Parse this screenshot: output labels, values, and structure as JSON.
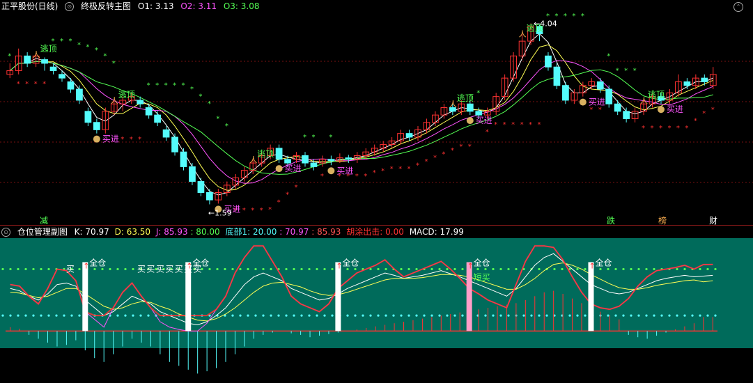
{
  "main_header": {
    "title": "正平股份(日线)",
    "indicator_name": "终极反转主图",
    "o1": "O1: 3.13",
    "o2": "O2: 3.11",
    "o3": "O3: 3.08"
  },
  "sub_header": {
    "indicator_name": "仓位管理副图",
    "k": "K: 70.97",
    "d": "D: 63.50",
    "j": "J: 85.93",
    "j_extra": ": 80.00",
    "bottom": "底部1: 20.00",
    "v2": ": 70.97",
    "v3": ": 85.93",
    "exit": "胡涂出击: 0.00",
    "macd": "MACD: 17.99"
  },
  "labels": {
    "escape": "逃顶",
    "buy": "买进",
    "full": "全仓",
    "buy_short": "买",
    "short_buy": "短买",
    "high": "4.04",
    "low": "1.59",
    "reduce": "减",
    "drop": "跌",
    "rank": "榜",
    "fin": "财"
  },
  "colors": {
    "up": "#ff3232",
    "down": "#54fcfc",
    "ma_white": "#ffffff",
    "ma_yellow": "#ffff54",
    "ma_magenta": "#ff54ff",
    "ma_green": "#54ff54",
    "sub_bg": "#006b5b",
    "grid": "#7a1010"
  },
  "chart_data": [
    {
      "type": "candlestick",
      "title": "终极反转主图",
      "y_range": [
        1.5,
        4.15
      ],
      "high_marker": 4.04,
      "low_marker": 1.59,
      "candles": [
        {
          "o": 3.35,
          "c": 3.4,
          "h": 3.5,
          "l": 3.3
        },
        {
          "o": 3.4,
          "c": 3.6,
          "h": 3.7,
          "l": 3.35
        },
        {
          "o": 3.6,
          "c": 3.5,
          "h": 3.65,
          "l": 3.45
        },
        {
          "o": 3.5,
          "c": 3.6,
          "h": 3.62,
          "l": 3.45
        },
        {
          "o": 3.55,
          "c": 3.5,
          "h": 3.58,
          "l": 3.4
        },
        {
          "o": 3.45,
          "c": 3.4,
          "h": 3.5,
          "l": 3.35
        },
        {
          "o": 3.35,
          "c": 3.3,
          "h": 3.4,
          "l": 3.25
        },
        {
          "o": 3.25,
          "c": 3.15,
          "h": 3.3,
          "l": 3.1
        },
        {
          "o": 3.15,
          "c": 3.0,
          "h": 3.2,
          "l": 2.95
        },
        {
          "o": 2.85,
          "c": 2.7,
          "h": 2.9,
          "l": 2.65
        },
        {
          "o": 2.7,
          "c": 2.6,
          "h": 2.75,
          "l": 2.55
        },
        {
          "o": 2.6,
          "c": 2.85,
          "h": 2.9,
          "l": 2.55
        },
        {
          "o": 2.85,
          "c": 2.95,
          "h": 3.0,
          "l": 2.8
        },
        {
          "o": 2.95,
          "c": 3.0,
          "h": 3.05,
          "l": 2.85
        },
        {
          "o": 3.0,
          "c": 3.05,
          "h": 3.1,
          "l": 2.95
        },
        {
          "o": 3.0,
          "c": 2.95,
          "h": 3.05,
          "l": 2.9
        },
        {
          "o": 2.9,
          "c": 2.8,
          "h": 2.95,
          "l": 2.75
        },
        {
          "o": 2.8,
          "c": 2.7,
          "h": 2.85,
          "l": 2.65
        },
        {
          "o": 2.6,
          "c": 2.5,
          "h": 2.65,
          "l": 2.45
        },
        {
          "o": 2.5,
          "c": 2.3,
          "h": 2.55,
          "l": 2.25
        },
        {
          "o": 2.3,
          "c": 2.1,
          "h": 2.35,
          "l": 2.05
        },
        {
          "o": 2.1,
          "c": 1.9,
          "h": 2.15,
          "l": 1.85
        },
        {
          "o": 1.9,
          "c": 1.75,
          "h": 1.95,
          "l": 1.7
        },
        {
          "o": 1.75,
          "c": 1.65,
          "h": 1.8,
          "l": 1.59
        },
        {
          "o": 1.65,
          "c": 1.75,
          "h": 1.8,
          "l": 1.6
        },
        {
          "o": 1.75,
          "c": 1.85,
          "h": 1.9,
          "l": 1.7
        },
        {
          "o": 1.85,
          "c": 1.95,
          "h": 2.0,
          "l": 1.8
        },
        {
          "o": 1.95,
          "c": 2.05,
          "h": 2.1,
          "l": 1.9
        },
        {
          "o": 2.05,
          "c": 2.15,
          "h": 2.2,
          "l": 2.0
        },
        {
          "o": 2.15,
          "c": 2.25,
          "h": 2.3,
          "l": 2.1
        },
        {
          "o": 2.25,
          "c": 2.35,
          "h": 2.4,
          "l": 2.2
        },
        {
          "o": 2.35,
          "c": 2.2,
          "h": 2.4,
          "l": 2.15
        },
        {
          "o": 2.2,
          "c": 2.15,
          "h": 2.25,
          "l": 2.1
        },
        {
          "o": 2.2,
          "c": 2.25,
          "h": 2.3,
          "l": 2.15
        },
        {
          "o": 2.25,
          "c": 2.15,
          "h": 2.3,
          "l": 2.1
        },
        {
          "o": 2.15,
          "c": 2.1,
          "h": 2.2,
          "l": 2.05
        },
        {
          "o": 2.15,
          "c": 2.2,
          "h": 2.25,
          "l": 2.1
        },
        {
          "o": 2.2,
          "c": 2.18,
          "h": 2.25,
          "l": 2.12
        },
        {
          "o": 2.18,
          "c": 2.22,
          "h": 2.28,
          "l": 2.15
        },
        {
          "o": 2.22,
          "c": 2.2,
          "h": 2.26,
          "l": 2.15
        },
        {
          "o": 2.2,
          "c": 2.25,
          "h": 2.3,
          "l": 2.15
        },
        {
          "o": 2.25,
          "c": 2.3,
          "h": 2.35,
          "l": 2.2
        },
        {
          "o": 2.3,
          "c": 2.35,
          "h": 2.4,
          "l": 2.25
        },
        {
          "o": 2.35,
          "c": 2.4,
          "h": 2.45,
          "l": 2.3
        },
        {
          "o": 2.4,
          "c": 2.45,
          "h": 2.5,
          "l": 2.35
        },
        {
          "o": 2.45,
          "c": 2.55,
          "h": 2.6,
          "l": 2.4
        },
        {
          "o": 2.55,
          "c": 2.5,
          "h": 2.6,
          "l": 2.45
        },
        {
          "o": 2.5,
          "c": 2.6,
          "h": 2.65,
          "l": 2.45
        },
        {
          "o": 2.6,
          "c": 2.7,
          "h": 2.75,
          "l": 2.55
        },
        {
          "o": 2.7,
          "c": 2.8,
          "h": 2.85,
          "l": 2.65
        },
        {
          "o": 2.8,
          "c": 2.9,
          "h": 2.95,
          "l": 2.75
        },
        {
          "o": 2.9,
          "c": 2.85,
          "h": 2.95,
          "l": 2.8
        },
        {
          "o": 2.85,
          "c": 2.95,
          "h": 3.0,
          "l": 2.8
        },
        {
          "o": 2.95,
          "c": 2.85,
          "h": 3.0,
          "l": 2.8
        },
        {
          "o": 2.85,
          "c": 2.8,
          "h": 2.9,
          "l": 2.75
        },
        {
          "o": 2.8,
          "c": 2.85,
          "h": 2.9,
          "l": 2.75
        },
        {
          "o": 2.85,
          "c": 3.05,
          "h": 3.1,
          "l": 2.8
        },
        {
          "o": 3.05,
          "c": 3.3,
          "h": 3.35,
          "l": 3.0
        },
        {
          "o": 3.3,
          "c": 3.6,
          "h": 3.65,
          "l": 3.25
        },
        {
          "o": 3.6,
          "c": 3.8,
          "h": 3.9,
          "l": 3.55
        },
        {
          "o": 3.8,
          "c": 4.0,
          "h": 4.04,
          "l": 3.75
        },
        {
          "o": 4.0,
          "c": 3.9,
          "h": 4.02,
          "l": 3.8
        },
        {
          "o": 3.6,
          "c": 3.45,
          "h": 3.65,
          "l": 3.4
        },
        {
          "o": 3.45,
          "c": 3.2,
          "h": 3.5,
          "l": 3.15
        },
        {
          "o": 3.2,
          "c": 3.0,
          "h": 3.25,
          "l": 2.95
        },
        {
          "o": 3.0,
          "c": 3.1,
          "h": 3.15,
          "l": 2.95
        },
        {
          "o": 3.1,
          "c": 3.2,
          "h": 3.25,
          "l": 3.05
        },
        {
          "o": 3.2,
          "c": 3.25,
          "h": 3.3,
          "l": 3.15
        },
        {
          "o": 3.25,
          "c": 3.15,
          "h": 3.3,
          "l": 3.1
        },
        {
          "o": 3.15,
          "c": 2.95,
          "h": 3.2,
          "l": 2.9
        },
        {
          "o": 2.95,
          "c": 2.85,
          "h": 3.0,
          "l": 2.8
        },
        {
          "o": 2.85,
          "c": 2.75,
          "h": 2.9,
          "l": 2.7
        },
        {
          "o": 2.75,
          "c": 2.85,
          "h": 2.9,
          "l": 2.7
        },
        {
          "o": 2.85,
          "c": 2.95,
          "h": 3.0,
          "l": 2.8
        },
        {
          "o": 2.95,
          "c": 3.05,
          "h": 3.1,
          "l": 2.9
        },
        {
          "o": 3.05,
          "c": 3.0,
          "h": 3.1,
          "l": 2.95
        },
        {
          "o": 3.0,
          "c": 3.1,
          "h": 3.15,
          "l": 2.95
        },
        {
          "o": 3.1,
          "c": 3.25,
          "h": 3.35,
          "l": 3.05
        },
        {
          "o": 3.25,
          "c": 3.2,
          "h": 3.3,
          "l": 3.15
        },
        {
          "o": 3.2,
          "c": 3.3,
          "h": 3.35,
          "l": 3.15
        },
        {
          "o": 3.3,
          "c": 3.25,
          "h": 3.35,
          "l": 3.2
        },
        {
          "o": 3.2,
          "c": 3.35,
          "h": 3.45,
          "l": 3.15
        }
      ],
      "signals": [
        {
          "kind": "escape",
          "i": 3
        },
        {
          "kind": "escape",
          "i": 12
        },
        {
          "kind": "buy",
          "i": 10
        },
        {
          "kind": "buy",
          "i": 24
        },
        {
          "kind": "escape",
          "i": 28
        },
        {
          "kind": "buy",
          "i": 31
        },
        {
          "kind": "buy",
          "i": 37
        },
        {
          "kind": "escape",
          "i": 51
        },
        {
          "kind": "buy",
          "i": 53
        },
        {
          "kind": "escape",
          "i": 59
        },
        {
          "kind": "buy",
          "i": 66
        },
        {
          "kind": "escape",
          "i": 73
        },
        {
          "kind": "buy",
          "i": 75
        }
      ]
    },
    {
      "type": "line+bar",
      "title": "仓位管理副图",
      "y_range": [
        -60,
        120
      ],
      "k": [
        55,
        52,
        45,
        40,
        48,
        60,
        62,
        58,
        40,
        30,
        20,
        25,
        35,
        45,
        40,
        35,
        25,
        20,
        15,
        10,
        8,
        12,
        20,
        30,
        45,
        60,
        70,
        75,
        70,
        65,
        55,
        50,
        45,
        40,
        42,
        48,
        55,
        60,
        65,
        70,
        75,
        72,
        68,
        70,
        72,
        75,
        78,
        74,
        70,
        65,
        60,
        55,
        50,
        45,
        55,
        70,
        85,
        95,
        100,
        90,
        80,
        70,
        60,
        55,
        50,
        48,
        50,
        55,
        60,
        65,
        68,
        70,
        72,
        70,
        70.97,
        72
      ],
      "d": [
        50,
        49,
        46,
        43,
        45,
        50,
        55,
        55,
        48,
        40,
        32,
        28,
        30,
        35,
        38,
        37,
        32,
        28,
        22,
        18,
        14,
        13,
        16,
        22,
        30,
        40,
        50,
        58,
        62,
        63,
        60,
        57,
        52,
        48,
        46,
        47,
        50,
        54,
        58,
        62,
        66,
        68,
        68,
        68,
        69,
        71,
        73,
        73,
        72,
        70,
        66,
        62,
        58,
        54,
        54,
        60,
        68,
        78,
        86,
        88,
        85,
        80,
        73,
        67,
        61,
        56,
        54,
        54,
        56,
        59,
        61,
        63,
        65,
        66,
        63.5,
        65
      ],
      "j": [
        60,
        58,
        45,
        35,
        55,
        80,
        78,
        65,
        25,
        15,
        5,
        30,
        50,
        62,
        45,
        30,
        12,
        5,
        2,
        0,
        0,
        10,
        28,
        45,
        75,
        95,
        110,
        110,
        90,
        70,
        45,
        35,
        30,
        25,
        35,
        55,
        65,
        75,
        80,
        85,
        92,
        80,
        70,
        75,
        80,
        85,
        90,
        80,
        68,
        55,
        48,
        40,
        35,
        30,
        60,
        90,
        110,
        110,
        108,
        92,
        70,
        50,
        35,
        30,
        28,
        32,
        42,
        58,
        70,
        78,
        80,
        82,
        85,
        80,
        85.93,
        86
      ],
      "macd": [
        5,
        3,
        -5,
        -10,
        -15,
        -20,
        -18,
        -12,
        -25,
        -35,
        -40,
        -30,
        -20,
        -10,
        -15,
        -20,
        -30,
        -40,
        -45,
        -50,
        -55,
        -52,
        -48,
        -40,
        -30,
        -20,
        -10,
        -5,
        -2,
        0,
        -3,
        -5,
        -8,
        -6,
        -4,
        -2,
        0,
        2,
        4,
        6,
        8,
        10,
        12,
        14,
        16,
        18,
        20,
        22,
        24,
        26,
        28,
        30,
        32,
        34,
        36,
        40,
        45,
        50,
        52,
        48,
        42,
        36,
        30,
        25,
        20,
        15,
        -5,
        -8,
        -10,
        -6,
        -2,
        2,
        6,
        10,
        17.99,
        18
      ],
      "full_markers": [
        8,
        19,
        35,
        49,
        62
      ],
      "short_buy_markers": [
        49
      ],
      "full_label": "全仓"
    }
  ]
}
